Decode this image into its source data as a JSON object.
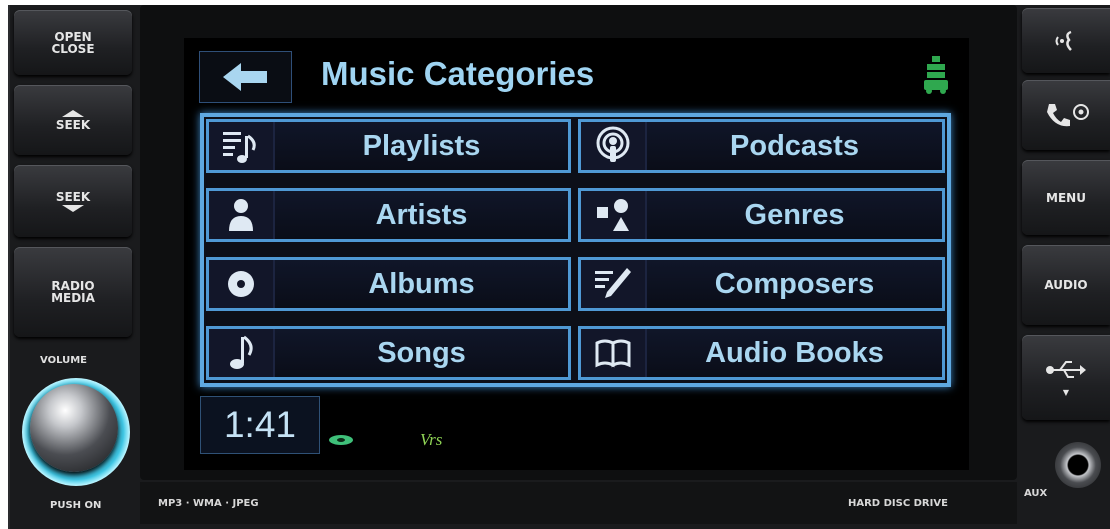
{
  "left_panel": {
    "open_close": [
      "OPEN",
      "CLOSE"
    ],
    "seek_up": "SEEK",
    "seek_down": "SEEK",
    "radio_media": [
      "RADIO",
      "MEDIA"
    ],
    "volume_label": "VOLUME",
    "push_on": "PUSH ON"
  },
  "screen": {
    "title": "Music Categories",
    "categories": [
      {
        "label": "Playlists",
        "icon": "playlist-icon"
      },
      {
        "label": "Podcasts",
        "icon": "podcast-icon"
      },
      {
        "label": "Artists",
        "icon": "artist-icon"
      },
      {
        "label": "Genres",
        "icon": "genres-icon"
      },
      {
        "label": "Albums",
        "icon": "album-icon"
      },
      {
        "label": "Composers",
        "icon": "composer-icon"
      },
      {
        "label": "Songs",
        "icon": "song-note-icon"
      },
      {
        "label": "Audio Books",
        "icon": "book-icon"
      }
    ],
    "clock": "1:41",
    "voice_text": "Vrs",
    "colors": {
      "accent": "#5ea8e0",
      "text": "#a9d6f0",
      "indicator": "#3fc07a"
    }
  },
  "bottom": {
    "formats": "MP3 · WMA · JPEG",
    "hdd": "HARD DISC DRIVE"
  },
  "right_panel": {
    "menu": "MENU",
    "audio": "AUDIO",
    "aux": "AUX"
  }
}
